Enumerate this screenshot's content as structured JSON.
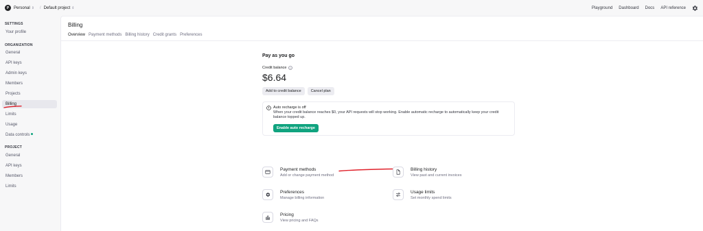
{
  "topbar": {
    "org_initial": "P",
    "org_name": "Personal",
    "project_name": "Default project",
    "links": [
      "Playground",
      "Dashboard",
      "Docs",
      "API reference"
    ]
  },
  "sidebar": {
    "settings_heading": "SETTINGS",
    "settings_items": [
      "Your profile"
    ],
    "organization_heading": "ORGANIZATION",
    "organization_items": [
      "General",
      "API keys",
      "Admin keys",
      "Members",
      "Projects",
      "Billing",
      "Limits",
      "Usage",
      "Data controls"
    ],
    "project_heading": "PROJECT",
    "project_items": [
      "General",
      "API keys",
      "Members",
      "Limits"
    ]
  },
  "page": {
    "title": "Billing",
    "tabs": [
      "Overview",
      "Payment methods",
      "Billing history",
      "Credit grants",
      "Preferences"
    ]
  },
  "billing": {
    "plan_title": "Pay as you go",
    "credit_label": "Credit balance",
    "balance": "$6.64",
    "add_credit_label": "Add to credit balance",
    "cancel_plan_label": "Cancel plan"
  },
  "alert": {
    "title": "Auto recharge is off",
    "body": "When your credit balance reaches $0, your API requests will stop working. Enable automatic recharge to automatically keep your credit balance topped up.",
    "button": "Enable auto recharge"
  },
  "links": [
    {
      "title": "Payment methods",
      "desc": "Add or change payment method",
      "icon": "credit-card-icon"
    },
    {
      "title": "Billing history",
      "desc": "View past and current invoices",
      "icon": "document-icon"
    },
    {
      "title": "Preferences",
      "desc": "Manage billing information",
      "icon": "gear-icon"
    },
    {
      "title": "Usage limits",
      "desc": "Set monthly spend limits",
      "icon": "sliders-icon"
    },
    {
      "title": "Pricing",
      "desc": "View pricing and FAQs",
      "icon": "pricing-icon"
    }
  ],
  "colors": {
    "accent": "#10a37f",
    "annotation_red": "#e0202a"
  }
}
